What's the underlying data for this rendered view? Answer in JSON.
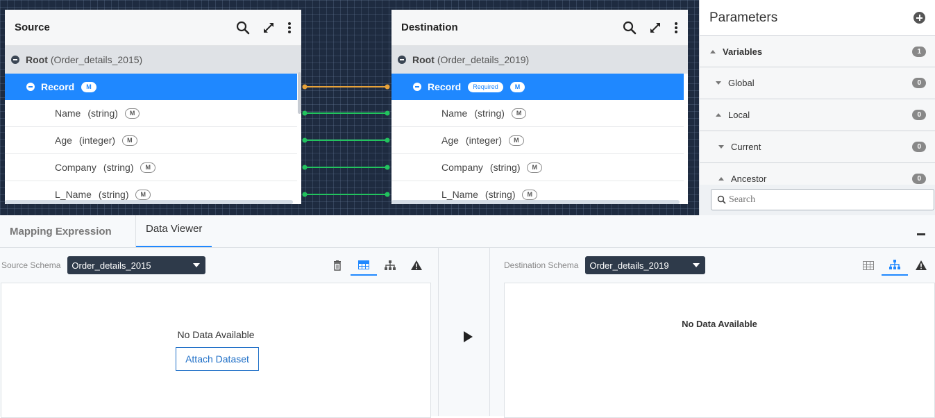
{
  "source": {
    "title": "Source",
    "root_label": "Root",
    "root_name": "(Order_details_2015)",
    "record_label": "Record",
    "record_badge": "M",
    "fields": [
      {
        "name": "Name",
        "type": "(string)",
        "badge": "M"
      },
      {
        "name": "Age",
        "type": "(integer)",
        "badge": "M"
      },
      {
        "name": "Company",
        "type": "(string)",
        "badge": "M"
      },
      {
        "name": "L_Name",
        "type": "(string)",
        "badge": "M"
      }
    ]
  },
  "destination": {
    "title": "Destination",
    "root_label": "Root",
    "root_name": "(Order_details_2019)",
    "record_label": "Record",
    "record_required": "Required",
    "record_badge": "M",
    "fields": [
      {
        "name": "Name",
        "type": "(string)",
        "badge": "M"
      },
      {
        "name": "Age",
        "type": "(integer)",
        "badge": "M"
      },
      {
        "name": "Company",
        "type": "(string)",
        "badge": "M"
      },
      {
        "name": "L_Name",
        "type": "(string)",
        "badge": "M"
      }
    ]
  },
  "connectors": {
    "record_color": "#e8a33a",
    "field_color": "#22c35e",
    "count_fields": 4
  },
  "parameters": {
    "title": "Parameters",
    "rows": [
      {
        "label": "Variables",
        "count": "1",
        "caret": "up"
      },
      {
        "label": "Global",
        "count": "0",
        "caret": "down"
      },
      {
        "label": "Local",
        "count": "0",
        "caret": "up"
      },
      {
        "label": "Current",
        "count": "0",
        "caret": "down"
      },
      {
        "label": "Ancestor",
        "count": "0",
        "caret": "up"
      }
    ],
    "search_placeholder": "Search"
  },
  "bottom": {
    "tabs": {
      "mapping": "Mapping Expression",
      "viewer": "Data Viewer"
    },
    "source_schema_label": "Source Schema",
    "source_schema_value": "Order_details_2015",
    "destination_schema_label": "Destination Schema",
    "destination_schema_value": "Order_details_2019",
    "source_empty": "No Data Available",
    "attach_label": "Attach Dataset",
    "destination_empty": "No Data Available"
  },
  "colors": {
    "accent": "#1f88ff",
    "canvas": "#1e2b40"
  }
}
